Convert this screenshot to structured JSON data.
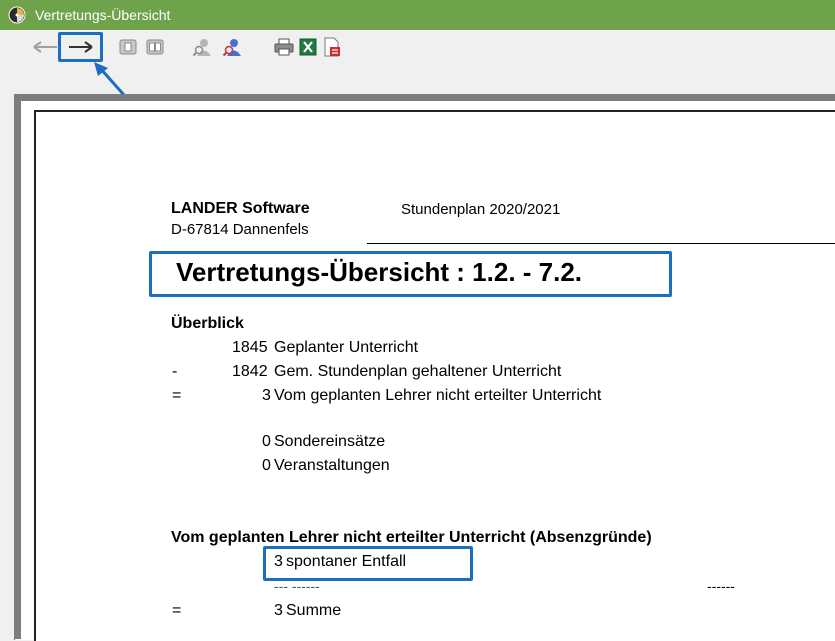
{
  "window": {
    "title": "Vertretungs-Übersicht"
  },
  "toolbar": {
    "buttons": [
      "back-arrow",
      "forward-arrow",
      "page-single",
      "page-double",
      "search-person-gray",
      "search-person",
      "print",
      "excel-export",
      "pdf-export"
    ]
  },
  "report": {
    "company": "LANDER Software",
    "location": "D-67814 Dannenfels",
    "schedule": "Stundenplan 2020/2021",
    "heading": "Vertretungs-Übersicht : 1.2. - 7.2.",
    "overview": {
      "title": "Überblick",
      "lines": [
        {
          "op": "",
          "num": "1845",
          "label": "Geplanter Unterricht"
        },
        {
          "op": "-",
          "num": "1842",
          "label": "Gem. Stundenplan gehaltener Unterricht"
        },
        {
          "op": "=",
          "num": "3",
          "label": "Vom geplanten Lehrer nicht erteilter Unterricht"
        }
      ],
      "extra": [
        {
          "num": "0",
          "label": "Sondereinsätze"
        },
        {
          "num": "0",
          "label": "Veranstaltungen"
        }
      ]
    },
    "absence": {
      "title": "Vom geplanten Lehrer nicht erteilter Unterricht (Absenzgründe)",
      "item_num": "3",
      "item_label": "spontaner Entfall",
      "dashes_left": "--- ------",
      "dashes_right": "------",
      "sum_op": "=",
      "sum_num": "3",
      "sum_label": "Summe"
    }
  },
  "colors": {
    "titlebar": "#6ea34b",
    "highlight": "#1b6ec2"
  }
}
